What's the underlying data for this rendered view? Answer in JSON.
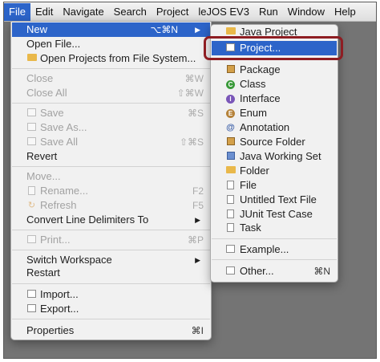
{
  "menubar": {
    "items": [
      "File",
      "Edit",
      "Navigate",
      "Search",
      "Project",
      "leJOS EV3",
      "Run",
      "Window",
      "Help"
    ]
  },
  "file_menu": {
    "items": [
      {
        "label": "New",
        "shortcut": "⌥⌘N",
        "submenu": true
      },
      {
        "label": "Open File..."
      },
      {
        "label": "Open Projects from File System..."
      },
      {
        "label": "Close",
        "shortcut": "⌘W"
      },
      {
        "label": "Close All",
        "shortcut": "⇧⌘W"
      },
      {
        "label": "Save",
        "shortcut": "⌘S"
      },
      {
        "label": "Save As..."
      },
      {
        "label": "Save All",
        "shortcut": "⇧⌘S"
      },
      {
        "label": "Revert"
      },
      {
        "label": "Move..."
      },
      {
        "label": "Rename...",
        "shortcut": "F2"
      },
      {
        "label": "Refresh",
        "shortcut": "F5"
      },
      {
        "label": "Convert Line Delimiters To",
        "submenu": true
      },
      {
        "label": "Print...",
        "shortcut": "⌘P"
      },
      {
        "label": "Switch Workspace",
        "submenu": true
      },
      {
        "label": "Restart"
      },
      {
        "label": "Import..."
      },
      {
        "label": "Export..."
      },
      {
        "label": "Properties",
        "shortcut": "⌘I"
      }
    ]
  },
  "new_submenu": {
    "items": [
      {
        "label": "Java Project"
      },
      {
        "label": "Project..."
      },
      {
        "label": "Package"
      },
      {
        "label": "Class"
      },
      {
        "label": "Interface"
      },
      {
        "label": "Enum"
      },
      {
        "label": "Annotation"
      },
      {
        "label": "Source Folder"
      },
      {
        "label": "Java Working Set"
      },
      {
        "label": "Folder"
      },
      {
        "label": "File"
      },
      {
        "label": "Untitled Text File"
      },
      {
        "label": "JUnit Test Case"
      },
      {
        "label": "Task"
      },
      {
        "label": "Example..."
      },
      {
        "label": "Other...",
        "shortcut": "⌘N"
      }
    ]
  },
  "submenu_arrow": "▶",
  "colors": {
    "highlight": "#2c64c9",
    "callout": "#8e1d22"
  }
}
